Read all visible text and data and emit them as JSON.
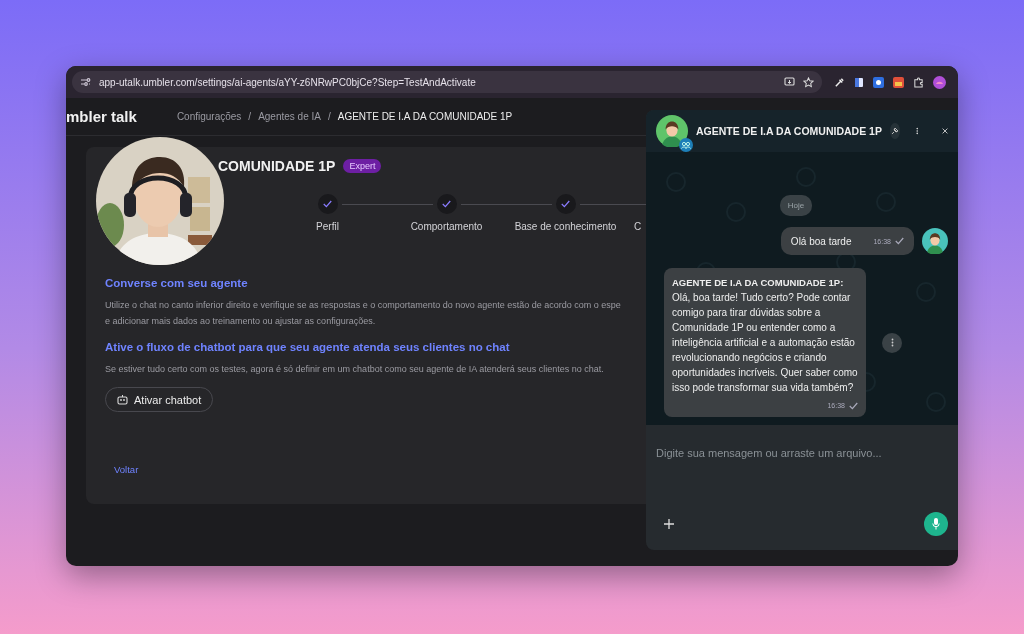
{
  "browser": {
    "url": "app-utalk.umbler.com/settings/ai-agents/aYY-z6NRwPC0bjCe?Step=TestAndActivate"
  },
  "header": {
    "logo": "mbler talk",
    "separator": "/",
    "breadcrumbs": [
      {
        "label": "Configurações",
        "current": false
      },
      {
        "label": "Agentes de IA",
        "current": false
      },
      {
        "label": "AGENTE DE I.A DA COMUNIDADE 1P",
        "current": true
      }
    ]
  },
  "agent": {
    "name": "COMUNIDADE 1P",
    "badge": "Expert"
  },
  "steps": [
    {
      "label": "Perfil",
      "done": true
    },
    {
      "label": "Comportamento",
      "done": true
    },
    {
      "label": "Base de conhecimento",
      "done": true
    },
    {
      "label": "C"
    }
  ],
  "sections": [
    {
      "title": "Converse com seu agente",
      "lines": [
        "Utilize o chat no canto inferior direito e verifique se as respostas e o comportamento do novo agente estão de acordo com o espe",
        "e adicionar mais dados ao treinamento ou ajustar as configurações."
      ]
    },
    {
      "title": "Ative o fluxo de chatbot para que seu agente atenda seus clientes no chat",
      "lines": [
        "Se estiver tudo certo com os testes, agora é só definir em um chatbot como seu agente de IA atenderá seus clientes no chat."
      ],
      "button": "Ativar chatbot"
    }
  ],
  "back_link": "Voltar",
  "chat": {
    "title": "AGENTE DE I.A DA COMUNIDADE 1P",
    "date_chip": "Hoje",
    "messages": [
      {
        "kind": "sent",
        "text": "Olá boa tarde",
        "time": "16:38"
      },
      {
        "kind": "received",
        "sender": "AGENTE DE I.A DA COMUNIDADE 1P:",
        "text": "Olá, boa tarde! Tudo certo? Pode contar comigo para tirar dúvidas sobre a Comunidade 1P ou entender como a inteligência artificial e a automação estão revolucionando negócios e criando oportunidades incríveis. Quer saber como isso pode transformar sua vida também?",
        "time": "16:38"
      }
    ],
    "composer": {
      "placeholder": "Digite sua mensagem ou arraste um arquivo..."
    }
  }
}
